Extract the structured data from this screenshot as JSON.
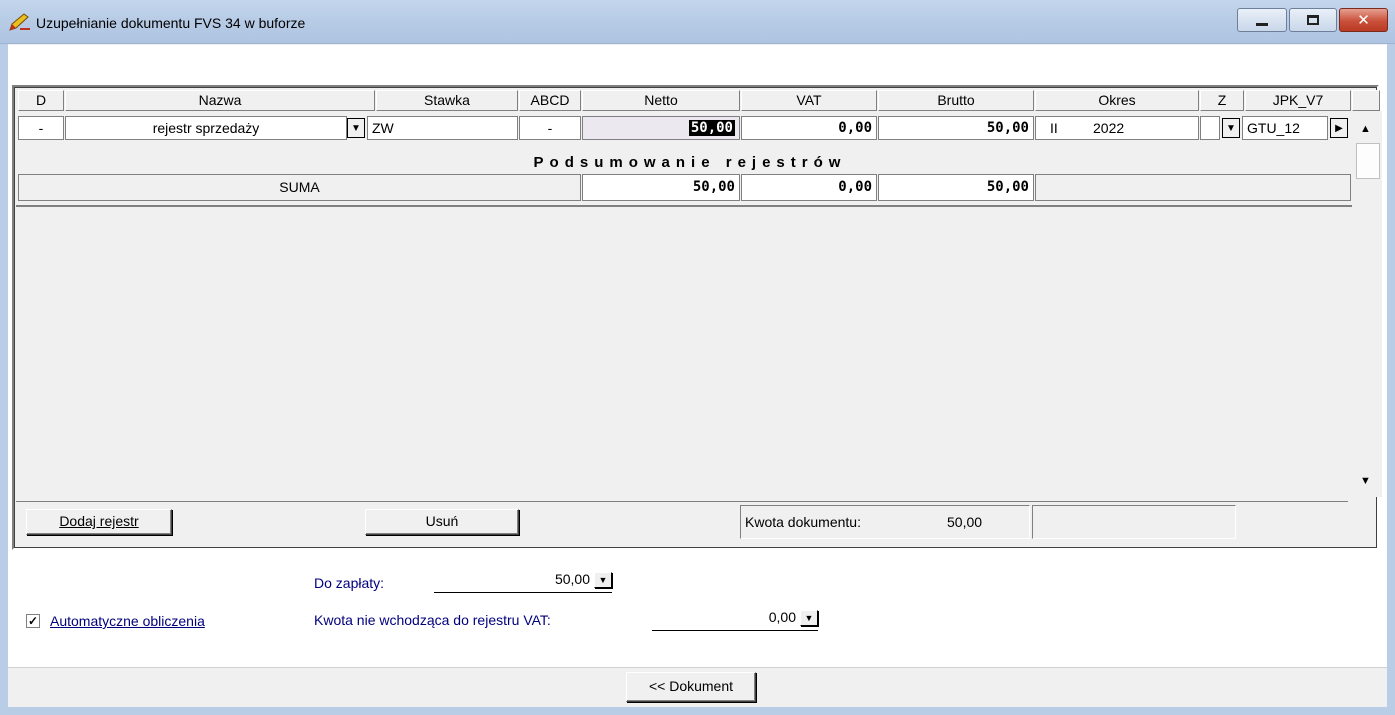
{
  "window": {
    "title": "Uzupełnianie dokumentu FVS 34 w buforze",
    "close_glyph": "✕"
  },
  "grid": {
    "headers": [
      "D",
      "Nazwa",
      "Stawka",
      "ABCD",
      "Netto",
      "VAT",
      "Brutto",
      "Okres",
      "Z",
      "JPK_V7"
    ],
    "row": {
      "d": "-",
      "nazwa": "rejestr sprzedaży",
      "stawka": "ZW",
      "abcd": "-",
      "netto": "50,00",
      "vat": "0,00",
      "brutto": "50,00",
      "okres_month": "II",
      "okres_year": "2022",
      "z": "",
      "jpk": "GTU_12"
    },
    "summary_title": "Podsumowanie rejestrów",
    "summary": {
      "label": "SUMA",
      "netto": "50,00",
      "vat": "0,00",
      "brutto": "50,00"
    }
  },
  "toolbar": {
    "add_label": "Dodaj rejestr",
    "remove_label": "Usuń",
    "kwota_label": "Kwota dokumentu:",
    "kwota_value": "50,00"
  },
  "form": {
    "do_zaplaty_label": "Do zapłaty:",
    "do_zaplaty_value": "50,00",
    "kwota_nie_label": "Kwota nie wchodząca do rejestru VAT:",
    "kwota_nie_value": "0,00",
    "auto_label": "Automatyczne obliczenia",
    "auto_checked": true
  },
  "footer": {
    "document_button": "<< Dokument"
  },
  "icons": {
    "title": "pencil-edit-icon",
    "dropdown": "dropdown-arrow-icon",
    "right": "right-arrow-icon"
  }
}
